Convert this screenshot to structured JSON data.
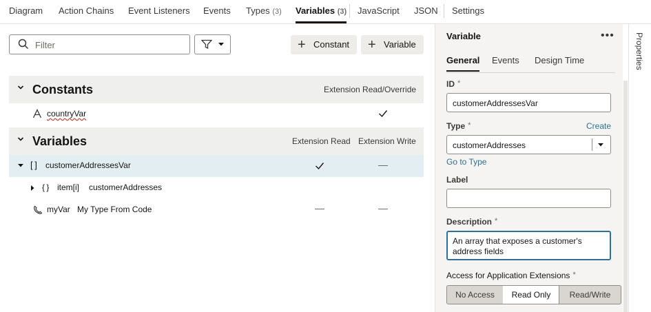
{
  "tabs": [
    {
      "label": "Diagram"
    },
    {
      "label": "Action Chains"
    },
    {
      "label": "Event Listeners"
    },
    {
      "label": "Events"
    },
    {
      "label": "Types",
      "count": "(3)"
    },
    {
      "label": "Variables",
      "count": "(3)"
    },
    {
      "label": "JavaScript"
    },
    {
      "label": "JSON"
    },
    {
      "label": "Settings"
    }
  ],
  "toolbar": {
    "filter_placeholder": "Filter",
    "constant_label": "Constant",
    "variable_label": "Variable"
  },
  "constants": {
    "title": "Constants",
    "col": "Extension Read/Override",
    "rows": [
      {
        "name": "countryVar",
        "icon": "text-type-icon",
        "override": true
      }
    ]
  },
  "variables": {
    "title": "Variables",
    "col_read": "Extension Read",
    "col_write": "Extension Write",
    "rows": [
      {
        "name": "customerAddressesVar",
        "icon": "array-icon",
        "read": "check",
        "write": "dash"
      },
      {
        "name": "item[i]",
        "type": "customerAddresses",
        "icon": "object-icon"
      },
      {
        "name": "myVar",
        "type": "My Type From Code",
        "icon": "callback-icon",
        "read": "dash",
        "write": "dash"
      }
    ]
  },
  "panel": {
    "title": "Variable",
    "tabs": [
      "General",
      "Events",
      "Design Time"
    ],
    "id_label": "ID",
    "id_value": "customerAddressesVar",
    "type_label": "Type",
    "create_link": "Create",
    "type_value": "customerAddresses",
    "goto_type": "Go to Type",
    "label_label": "Label",
    "label_value": "",
    "description_label": "Description",
    "description_value": "An array that exposes a customer's address fields",
    "access_label": "Access for Application Extensions",
    "access_options": [
      "No Access",
      "Read Only",
      "Read/Write"
    ],
    "access_selected": "Read Only"
  },
  "side_tab": "Properties",
  "colors": {
    "accent": "#2f6f8f",
    "selected_row": "#e3eef2"
  }
}
